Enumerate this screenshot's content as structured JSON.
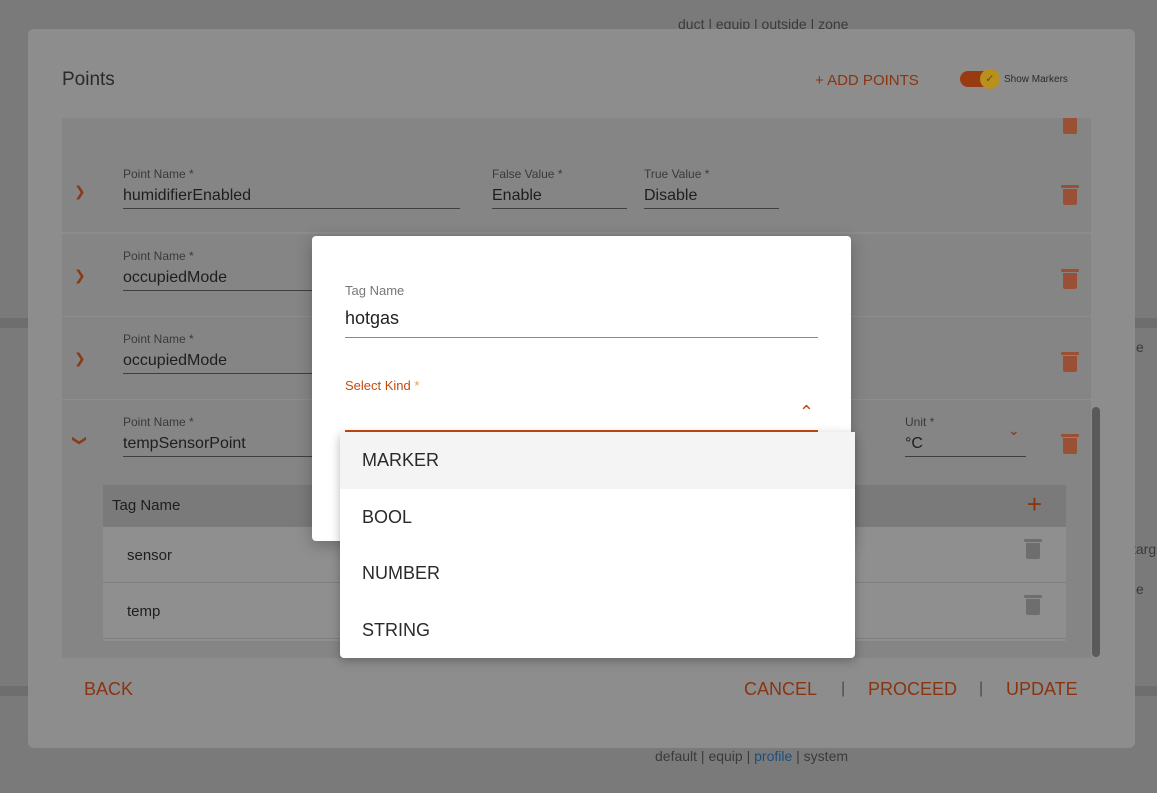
{
  "background": {
    "top_links": "duct | equip | outside | zone",
    "bottom_links": {
      "before": "default | equip | ",
      "highlight": "profile",
      "after": " | system"
    },
    "edge_texts": [
      "e",
      "targ",
      "e"
    ]
  },
  "modal": {
    "title": "Points",
    "add_points_label": "+ ADD POINTS",
    "show_markers_label": "Show Markers",
    "toggle_check": "✓",
    "partial_row": {},
    "rows": [
      {
        "point_name_label": "Point Name *",
        "point_name": "humidifierEnabled",
        "false_label": "False Value *",
        "false_value": "Enable",
        "true_label": "True Value *",
        "true_value": "Disable"
      },
      {
        "point_name_label": "Point Name *",
        "point_name": "occupiedMode"
      },
      {
        "point_name_label": "Point Name *",
        "point_name": "occupiedMode"
      },
      {
        "point_name_label": "Point Name *",
        "point_name": "tempSensorPoint",
        "unit_label": "Unit *",
        "unit_value": "°C"
      }
    ],
    "tag_table": {
      "header": "Tag Name",
      "add_icon": "+",
      "rows": [
        "sensor",
        "temp"
      ]
    },
    "footer": {
      "back": "BACK",
      "cancel": "CANCEL",
      "proceed": "PROCEED",
      "update": "UPDATE",
      "separator": "|"
    }
  },
  "dialog": {
    "tag_name_label": "Tag Name",
    "tag_name_value": "hotgas",
    "select_kind_label": "Select Kind",
    "required_mark": "*",
    "options": [
      "MARKER",
      "BOOL",
      "NUMBER",
      "STRING"
    ],
    "highlighted_option": "MARKER"
  },
  "colors": {
    "accent": "#c44a12",
    "overlay": "#7a7a7a",
    "dialog_bg": "#ffffff"
  }
}
